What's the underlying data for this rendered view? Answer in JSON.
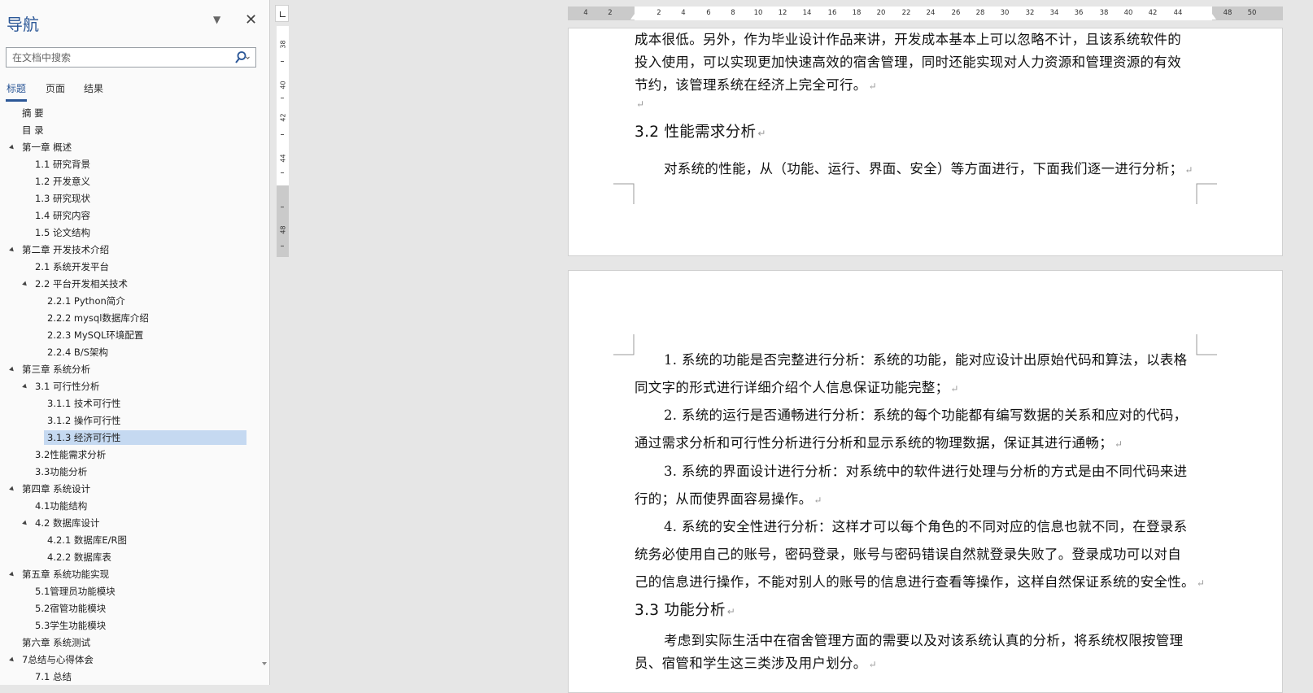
{
  "nav": {
    "title": "导航",
    "search_placeholder": "在文档中搜索",
    "tabs": [
      "标题",
      "页面",
      "结果"
    ],
    "active_tab": 0,
    "tree": [
      {
        "label": "摘  要",
        "level": 1,
        "arrow": false
      },
      {
        "label": "目  录",
        "level": 1,
        "arrow": false
      },
      {
        "label": "第一章 概述",
        "level": 1,
        "arrow": true
      },
      {
        "label": "1.1 研究背景",
        "level": 2,
        "arrow": false
      },
      {
        "label": "1.2 开发意义",
        "level": 2,
        "arrow": false
      },
      {
        "label": "1.3 研究现状",
        "level": 2,
        "arrow": false
      },
      {
        "label": "1.4 研究内容",
        "level": 2,
        "arrow": false
      },
      {
        "label": "1.5 论文结构",
        "level": 2,
        "arrow": false
      },
      {
        "label": "第二章 开发技术介绍",
        "level": 1,
        "arrow": true
      },
      {
        "label": "2.1 系统开发平台",
        "level": 2,
        "arrow": false
      },
      {
        "label": "2.2 平台开发相关技术",
        "level": 2,
        "arrow": true
      },
      {
        "label": "2.2.1   Python简介",
        "level": 3,
        "arrow": false
      },
      {
        "label": "2.2.2   mysql数据库介绍",
        "level": 3,
        "arrow": false
      },
      {
        "label": "2.2.3   MySQL环境配置",
        "level": 3,
        "arrow": false
      },
      {
        "label": "2.2.4   B/S架构",
        "level": 3,
        "arrow": false
      },
      {
        "label": "第三章 系统分析",
        "level": 1,
        "arrow": true
      },
      {
        "label": "3.1 可行性分析",
        "level": 2,
        "arrow": true
      },
      {
        "label": "3.1.1 技术可行性",
        "level": 3,
        "arrow": false
      },
      {
        "label": "3.1.2 操作可行性",
        "level": 3,
        "arrow": false
      },
      {
        "label": "3.1.3 经济可行性",
        "level": 3,
        "arrow": false,
        "selected": true
      },
      {
        "label": "3.2性能需求分析",
        "level": 2,
        "arrow": false
      },
      {
        "label": "3.3功能分析",
        "level": 2,
        "arrow": false
      },
      {
        "label": "第四章 系统设计",
        "level": 1,
        "arrow": true
      },
      {
        "label": "4.1功能结构",
        "level": 2,
        "arrow": false
      },
      {
        "label": "4.2 数据库设计",
        "level": 2,
        "arrow": true
      },
      {
        "label": "4.2.1 数据库E/R图",
        "level": 3,
        "arrow": false
      },
      {
        "label": "4.2.2 数据库表",
        "level": 3,
        "arrow": false
      },
      {
        "label": "第五章 系统功能实现",
        "level": 1,
        "arrow": true
      },
      {
        "label": "5.1管理员功能模块",
        "level": 2,
        "arrow": false
      },
      {
        "label": "5.2宿管功能模块",
        "level": 2,
        "arrow": false
      },
      {
        "label": "5.3学生功能模块",
        "level": 2,
        "arrow": false
      },
      {
        "label": "第六章 系统测试",
        "level": 1,
        "arrow": false
      },
      {
        "label": "7总结与心得体会",
        "level": 1,
        "arrow": true
      },
      {
        "label": "7.1 总结",
        "level": 2,
        "arrow": false
      }
    ]
  },
  "rulers": {
    "horizontal": [
      "4",
      "2",
      "2",
      "4",
      "6",
      "8",
      "10",
      "12",
      "14",
      "16",
      "18",
      "20",
      "22",
      "24",
      "26",
      "28",
      "30",
      "32",
      "34",
      "36",
      "38",
      "40",
      "42",
      "44",
      "48",
      "50"
    ],
    "vertical": [
      "38",
      "40",
      "42",
      "44",
      "48"
    ]
  },
  "document": {
    "page1": {
      "lines": [
        "成本很低。另外，作为毕业设计作品来讲，开发成本基本上可以忽略不计，且该系统软件的",
        "投入使用，可以实现更加快速高效的宿舍管理，同时还能实现对人力资源和管理资源的有效",
        "节约，该管理系统在经济上完全可行。"
      ],
      "heading": "3.2 性能需求分析",
      "intro": "对系统的性能，从（功能、运行、界面、安全）等方面进行，下面我们逐一进行分析；"
    },
    "page2": {
      "items": [
        [
          "1.  系统的功能是否完整进行分析：系统的功能，能对应设计出原始代码和算法，以表格",
          "同文字的形式进行详细介绍个人信息保证功能完整；"
        ],
        [
          "2.  系统的运行是否通畅进行分析：系统的每个功能都有编写数据的关系和应对的代码，",
          "通过需求分析和可行性分析进行分析和显示系统的物理数据，保证其进行通畅；"
        ],
        [
          "3.  系统的界面设计进行分析：对系统中的软件进行处理与分析的方式是由不同代码来进",
          "行的；从而使界面容易操作。"
        ],
        [
          "4.  系统的安全性进行分析：这样才可以每个角色的不同对应的信息也就不同，在登录系",
          "统务必使用自己的账号，密码登录，账号与密码错误自然就登录失败了。登录成功可以对自",
          "己的信息进行操作，不能对别人的账号的信息进行查看等操作，这样自然保证系统的安全性。"
        ]
      ],
      "heading": "3.3 功能分析",
      "para": [
        "考虑到实际生活中在宿舍管理方面的需要以及对该系统认真的分析，将系统权限按管理",
        "员、宿管和学生这三类涉及用户划分。"
      ]
    }
  },
  "colors": {
    "accent": "#2b5797",
    "selection": "#c5d9f1"
  }
}
